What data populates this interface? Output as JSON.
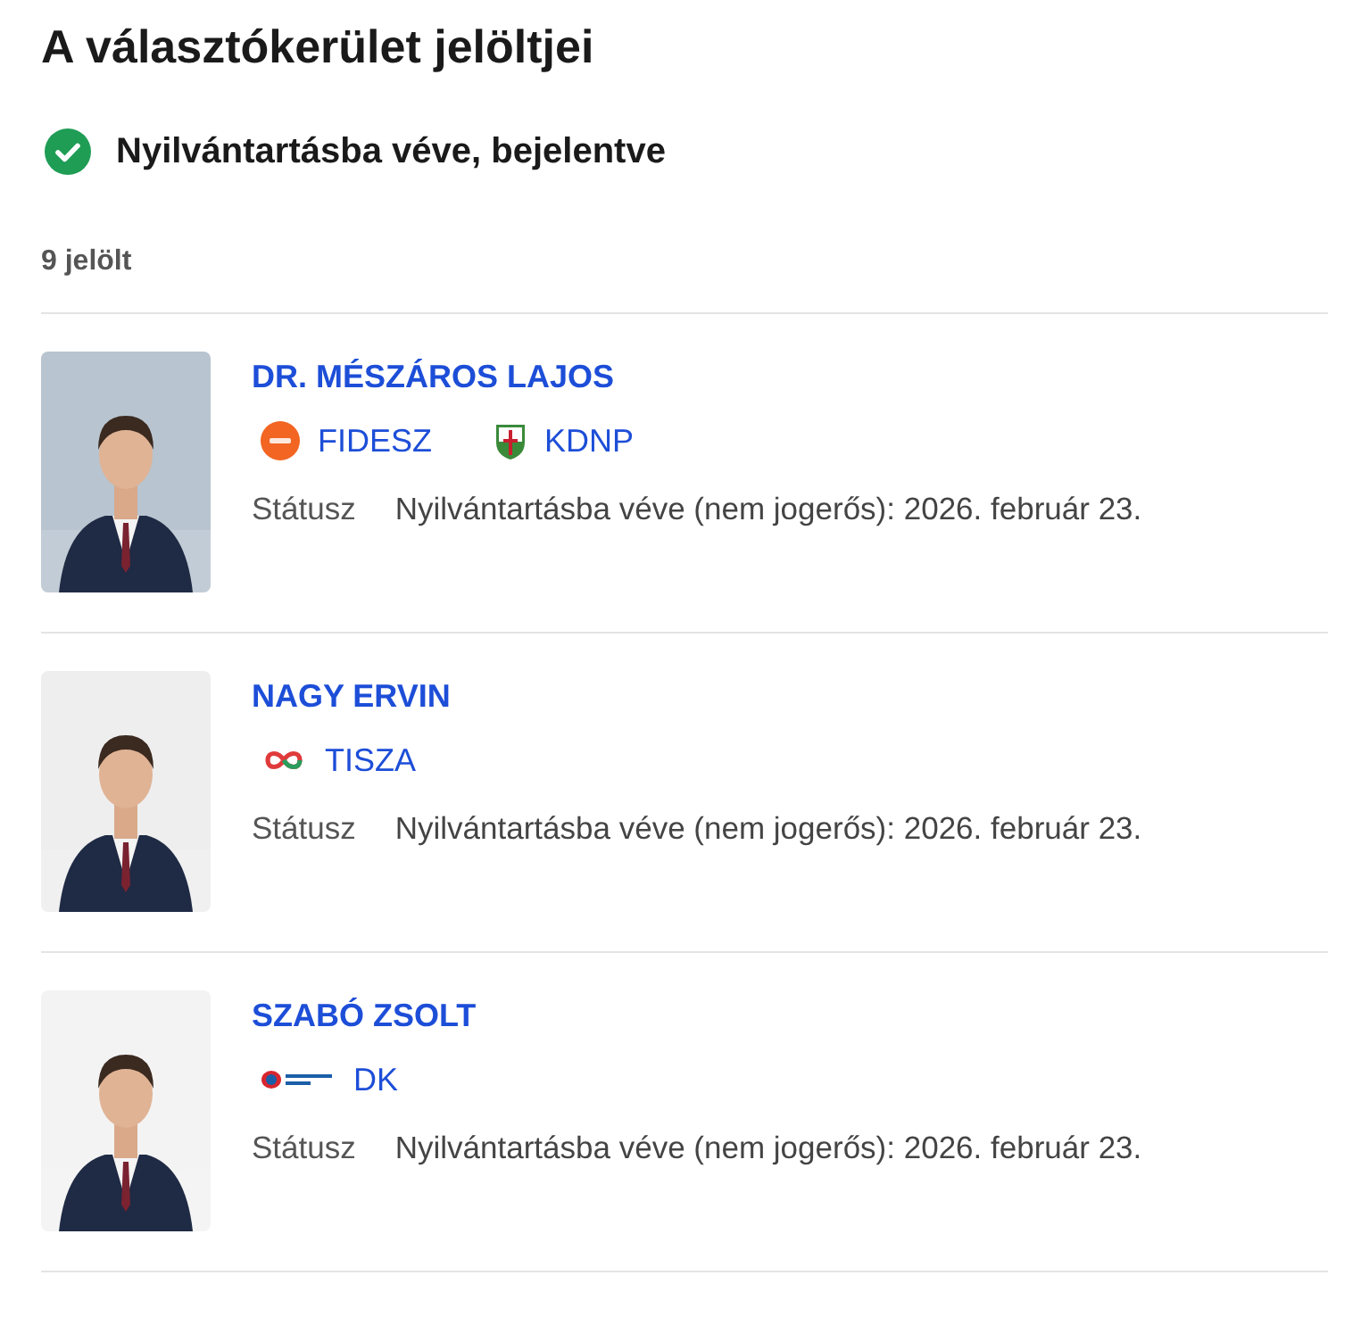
{
  "title": "A választókerület jelöltjei",
  "status_banner": {
    "text": "Nyilvántartásba véve, bejelentve",
    "kind": "success"
  },
  "count": "9 jelölt",
  "candidates": [
    {
      "name": "DR. MÉSZÁROS LAJOS",
      "photo": {
        "kind": "picture"
      },
      "parties": [
        {
          "name": "FIDESZ",
          "kind": "fidesz"
        },
        {
          "name": "KDNP",
          "kind": "kdnp"
        }
      ],
      "status_label": "Státusz",
      "status_value": "Nyilvántartásba véve (nem jogerős): 2026. február 23."
    },
    {
      "name": "NAGY ERVIN",
      "photo": {
        "kind": "picture"
      },
      "parties": [
        {
          "name": "TISZA",
          "kind": "tisza"
        }
      ],
      "status_label": "Státusz",
      "status_value": "Nyilvántartásba véve (nem jogerős): 2026. február 23."
    },
    {
      "name": "SZABÓ ZSOLT",
      "photo": {
        "kind": "picture"
      },
      "parties": [
        {
          "name": "DK",
          "kind": "dk"
        }
      ],
      "status_label": "Státusz",
      "status_value": "Nyilvántartásba véve (nem jogerős): 2026. február 23."
    }
  ]
}
